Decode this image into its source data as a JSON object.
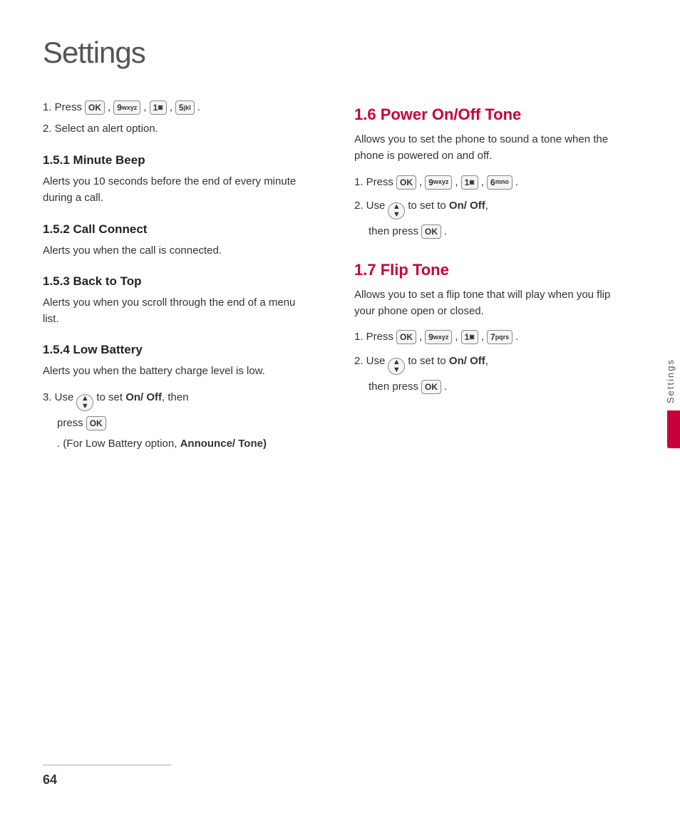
{
  "page": {
    "title": "Settings",
    "page_number": "64"
  },
  "sidebar": {
    "label": "Settings"
  },
  "left_column": {
    "intro_steps": [
      {
        "num": "1.",
        "text": "Press",
        "keys": [
          "OK",
          "9wxyz",
          "1",
          "5jkl"
        ],
        "separators": [
          ",",
          ",",
          ","
        ]
      },
      {
        "num": "2.",
        "text": "Select an alert option."
      }
    ],
    "sections": [
      {
        "id": "1.5.1",
        "heading": "1.5.1 Minute Beep",
        "body": "Alerts you 10 seconds before the end of every minute during a call."
      },
      {
        "id": "1.5.2",
        "heading": "1.5.2 Call Connect",
        "body": "Alerts you when the call is connected."
      },
      {
        "id": "1.5.3",
        "heading": "1.5.3 Back to Top",
        "body": "Alerts you when you scroll through the end of a menu list."
      },
      {
        "id": "1.5.4",
        "heading": "1.5.4 Low Battery",
        "body": "Alerts you when the battery charge level is low."
      }
    ],
    "low_battery_steps": [
      {
        "num": "3.",
        "text": "Use",
        "nav": true,
        "text2": "to set",
        "bold": "On/ Off",
        "text3": ", then"
      },
      {
        "indent": true,
        "text": "press",
        "key": "OK",
        "text2": ". (For Low Battery option,",
        "bold": "Announce/ Tone)"
      }
    ]
  },
  "right_column": {
    "sections": [
      {
        "id": "1.6",
        "heading": "1.6 Power On/Off Tone",
        "body": "Allows you to set the phone to sound a tone when the phone is powered on and off.",
        "steps": [
          {
            "num": "1.",
            "text": "Press",
            "keys": [
              "OK",
              "9wxyz",
              "1",
              "6mno"
            ],
            "separators": [
              ",",
              ",",
              ","
            ]
          },
          {
            "num": "2.",
            "text": "Use",
            "nav": true,
            "text2": "to set to",
            "bold": "On/ Off",
            "text3": ",",
            "indent_text": "then press",
            "indent_key": "OK",
            "indent_dot": "."
          }
        ]
      },
      {
        "id": "1.7",
        "heading": "1.7 Flip Tone",
        "body": "Allows you to set a flip tone that will play when you flip your phone open or closed.",
        "steps": [
          {
            "num": "1.",
            "text": "Press",
            "keys": [
              "OK",
              "9wxyz",
              "1",
              "7pqrs"
            ],
            "separators": [
              ",",
              ",",
              ","
            ]
          },
          {
            "num": "2.",
            "text": "Use",
            "nav": true,
            "text2": "to set to",
            "bold": "On/ Off",
            "text3": ",",
            "indent_text": "then press",
            "indent_key": "OK",
            "indent_dot": "."
          }
        ]
      }
    ]
  },
  "keys": {
    "OK": "OK",
    "9wxyz_top": "9",
    "9wxyz_bot": "wxyz",
    "1_top": "1",
    "5jkl_top": "5",
    "5jkl_bot": "jkl",
    "6mno_top": "6",
    "6mno_bot": "mno",
    "7pqrs_top": "7",
    "7pqrs_bot": "pqrs"
  }
}
